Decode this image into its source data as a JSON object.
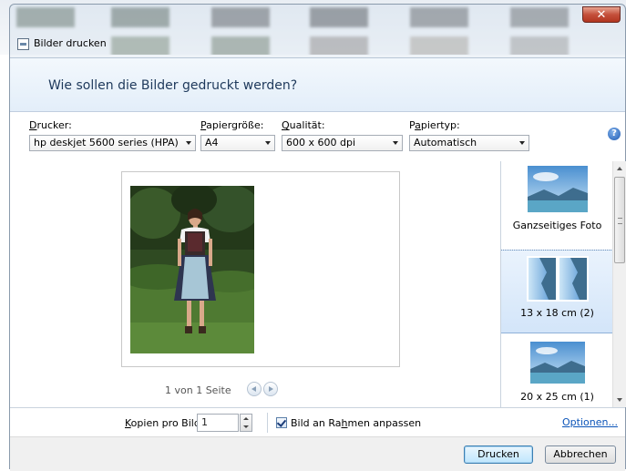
{
  "window": {
    "title": "Bilder drucken",
    "close_glyph": "✕"
  },
  "header": {
    "question": "Wie sollen die Bilder gedruckt werden?"
  },
  "controls": {
    "printer": {
      "label": "Drucker:",
      "value": "hp deskjet 5600 series (HPA)"
    },
    "paper_size": {
      "label": "Papiergröße:",
      "value": "A4"
    },
    "quality": {
      "label": "Qualität:",
      "value": "600 x 600 dpi"
    },
    "paper_type": {
      "label": "Papiertyp:",
      "value": "Automatisch"
    },
    "help_glyph": "?"
  },
  "preview": {
    "page_info": "1 von 1 Seite"
  },
  "layouts": [
    {
      "label": "Ganzseitiges Foto",
      "selected": false
    },
    {
      "label": "13 x 18 cm (2)",
      "selected": true
    },
    {
      "label": "20 x 25 cm (1)",
      "selected": false
    }
  ],
  "options": {
    "copies_label": "Kopien pro Bild:",
    "copies_value": "1",
    "fit_label": "Bild an Rahmen anpassen",
    "fit_checked": true,
    "options_link": "Optionen..."
  },
  "footer": {
    "print_button": "Drucken",
    "cancel_button": "Abbrechen"
  },
  "colors": {
    "header_text": "#1e395b",
    "link": "#0a53b8",
    "close_button": "#c4503b"
  }
}
